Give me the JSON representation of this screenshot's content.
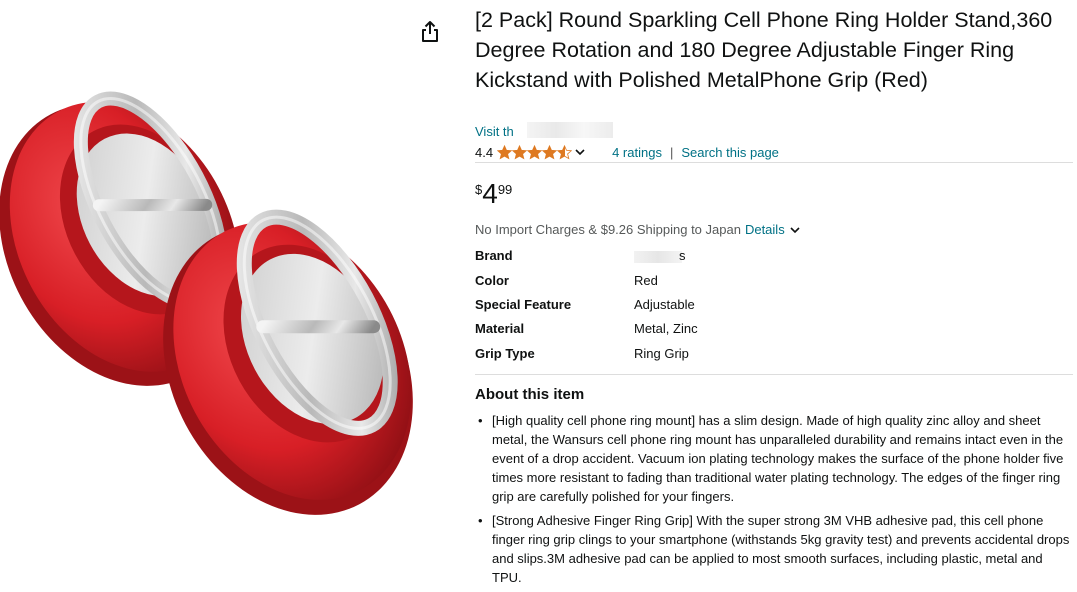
{
  "product": {
    "title": "[2 Pack] Round Sparkling Cell Phone Ring Holder Stand,360 Degree Rotation and 180 Degree Adjustable Finger Ring Kickstand with Polished MetalPhone Grip (Red)",
    "visit_store": "Visit th",
    "rating_value": "4.4",
    "rating_stars": 4.4,
    "ratings_link": "4 ratings",
    "separator": "|",
    "search_link": "Search this page",
    "price": {
      "symbol": "$",
      "whole": "4",
      "fraction": "99"
    },
    "shipping_text": "No Import Charges & $9.26 Shipping to Japan",
    "details_link": "Details"
  },
  "specs": [
    {
      "label": "Brand",
      "value": "s"
    },
    {
      "label": "Color",
      "value": "Red"
    },
    {
      "label": "Special Feature",
      "value": "Adjustable"
    },
    {
      "label": "Material",
      "value": "Metal, Zinc"
    },
    {
      "label": "Grip Type",
      "value": "Ring Grip"
    }
  ],
  "about": {
    "heading": "About this item",
    "bullets": [
      "[High quality cell phone ring mount] has a slim design. Made of high quality zinc alloy and sheet metal, the Wansurs cell phone ring mount has unparalleled durability and remains intact even in the event of a drop accident. Vacuum ion plating technology makes the surface of the phone holder five times more resistant to fading than traditional water plating technology. The edges of the finger ring grip are carefully polished for your fingers.",
      "[Strong Adhesive Finger Ring Grip] With the super strong 3M VHB adhesive pad, this cell phone finger ring grip clings to your smartphone (withstands 5kg gravity test) and prevents accidental drops and slips.3M adhesive pad can be applied to most smooth surfaces, including plastic, metal and TPU."
    ]
  },
  "icons": {
    "share": "share-icon",
    "star": "star-icon",
    "chevron": "chevron-down-icon"
  },
  "colors": {
    "star": "#DE7921",
    "link": "#007185",
    "product_red": "#D81F26"
  }
}
